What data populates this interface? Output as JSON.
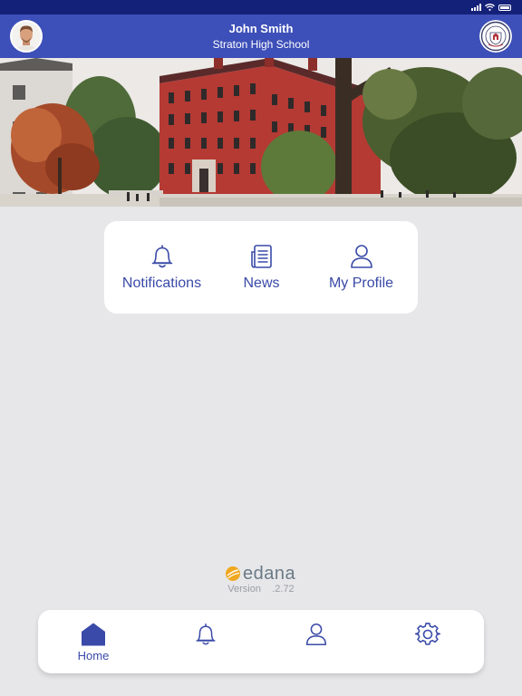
{
  "header": {
    "user_name": "John Smith",
    "school_name": "Straton High School"
  },
  "quick_actions": [
    {
      "label": "Notifications",
      "icon": "bell-icon"
    },
    {
      "label": "News",
      "icon": "newspaper-icon"
    },
    {
      "label": "My Profile",
      "icon": "user-icon"
    }
  ],
  "brand": {
    "name": "edana",
    "version_text": "Version    .2.72"
  },
  "bottom_nav": [
    {
      "label": "Home",
      "icon": "home-icon",
      "active": true
    },
    {
      "label": "",
      "icon": "bell-icon",
      "active": false
    },
    {
      "label": "",
      "icon": "user-icon",
      "active": false
    },
    {
      "label": "",
      "icon": "gear-icon",
      "active": false
    }
  ],
  "colors": {
    "status_bar": "#142178",
    "header": "#3d4fb8",
    "accent": "#3a4aa8",
    "background": "#e7e7e9",
    "brand_logo": "#f0a820"
  }
}
